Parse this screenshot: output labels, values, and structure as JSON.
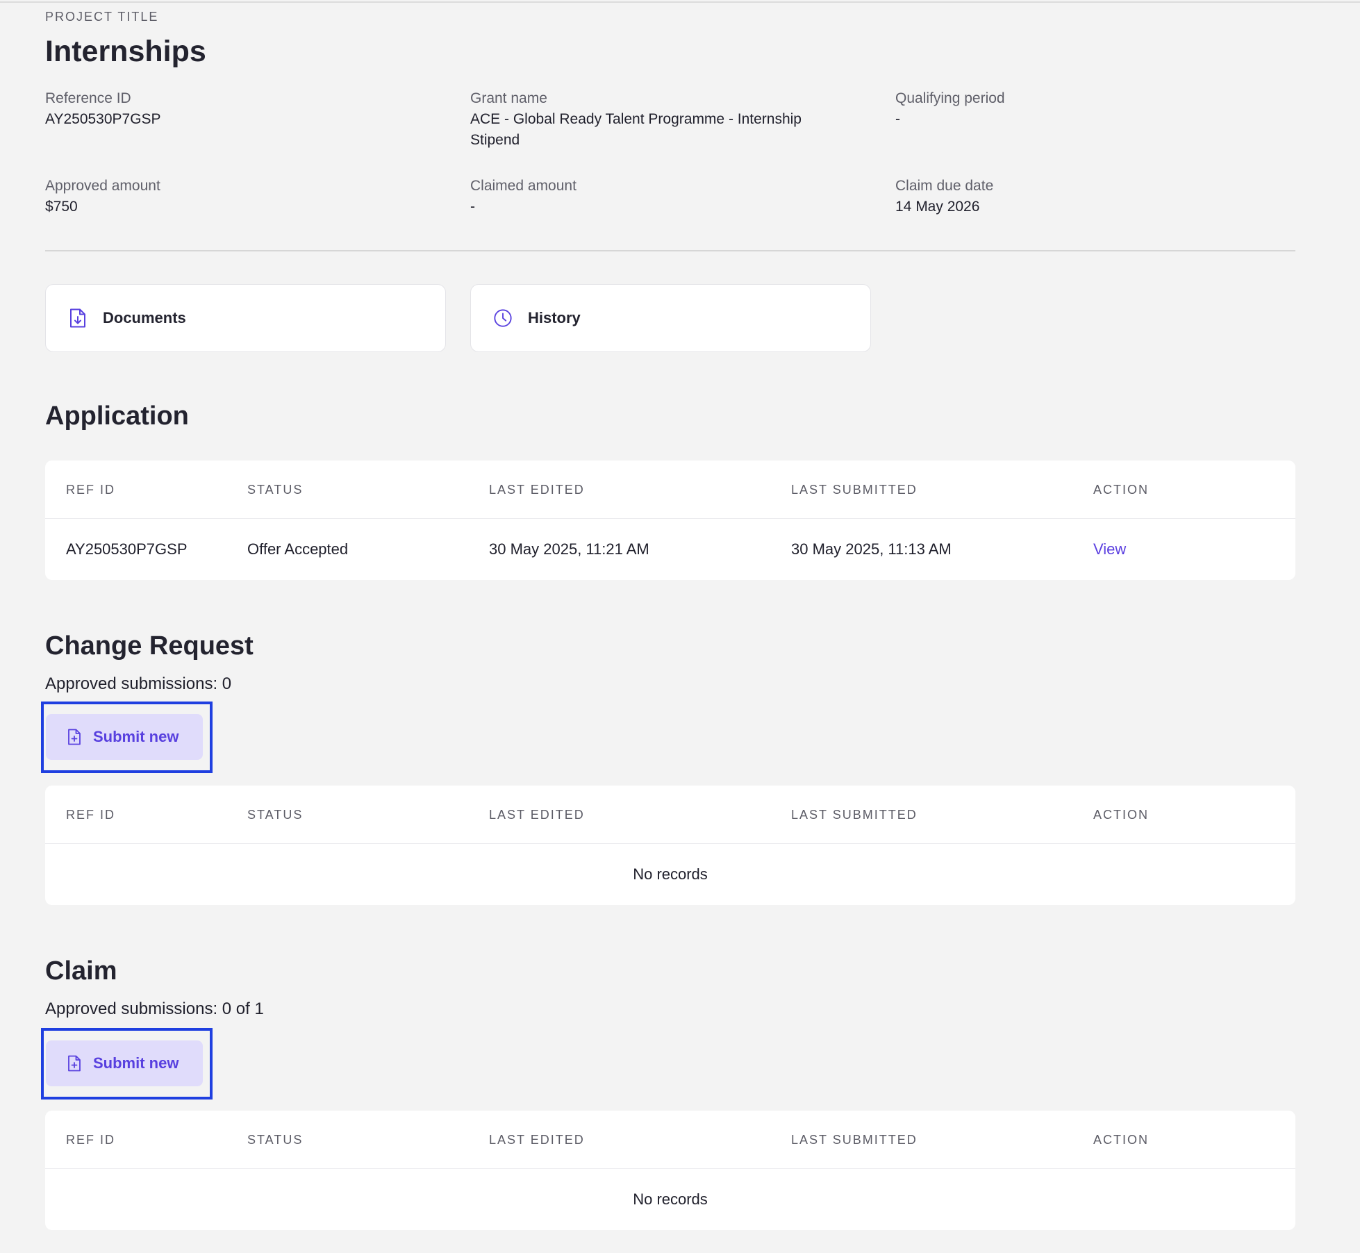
{
  "project": {
    "eyebrow": "PROJECT TITLE",
    "title": "Internships",
    "fields": {
      "reference_id": {
        "label": "Reference ID",
        "value": "AY250530P7GSP"
      },
      "grant_name": {
        "label": "Grant name",
        "value_line1": "ACE - Global Ready Talent Programme - Internship",
        "value_line2": "Stipend"
      },
      "qualifying_period": {
        "label": "Qualifying period",
        "value": "-"
      },
      "approved_amount": {
        "label": "Approved amount",
        "value": "$750"
      },
      "claimed_amount": {
        "label": "Claimed amount",
        "value": "-"
      },
      "claim_due_date": {
        "label": "Claim due date",
        "value": "14 May 2026"
      }
    }
  },
  "cards": {
    "documents": {
      "label": "Documents",
      "icon": "file-download-icon"
    },
    "history": {
      "label": "History",
      "icon": "clock-icon"
    }
  },
  "columns": [
    "REF ID",
    "STATUS",
    "LAST EDITED",
    "LAST SUBMITTED",
    "ACTION"
  ],
  "application": {
    "heading": "Application",
    "row": {
      "ref_id": "AY250530P7GSP",
      "status": "Offer Accepted",
      "last_edited": "30 May 2025, 11:21 AM",
      "last_submitted": "30 May 2025, 11:13 AM",
      "action": "View"
    }
  },
  "change_request": {
    "heading": "Change Request",
    "approved": "Approved submissions: 0",
    "button": "Submit new",
    "empty": "No records"
  },
  "claim": {
    "heading": "Claim",
    "approved": "Approved submissions: 0 of 1",
    "button": "Submit new",
    "empty": "No records"
  },
  "colors": {
    "accent": "#5840df",
    "button_bg": "#e0dcfb",
    "highlight_border": "#1f3fe0",
    "background": "#f3f3f3"
  }
}
